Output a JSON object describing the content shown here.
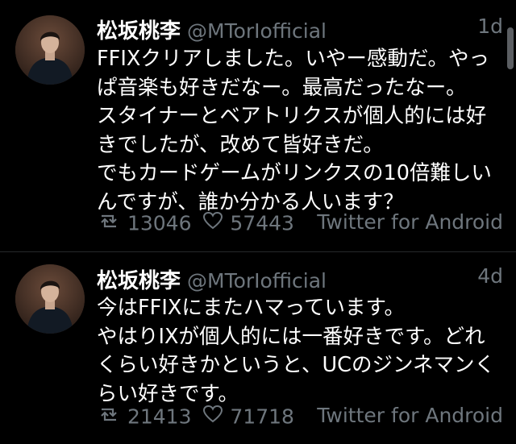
{
  "tweets": [
    {
      "display_name": "松坂桃李",
      "handle": "@MTorIofficial",
      "time": "1d",
      "lines": [
        "FFIXクリアしました。いやー感動だ。やっ",
        "ぱ音楽も好きだなー。最高だったなー。",
        "スタイナーとベアトリクスが個人的には好",
        "きでしたが、改めて皆好きだ。",
        "でもカードゲームがリンクスの10倍難しい",
        "んですが、誰か分かる人います？"
      ],
      "retweets": "13046",
      "likes": "57443",
      "source": "Twitter for Android",
      "retweet_icon": "retweet-icon",
      "like_icon": "heart-icon"
    },
    {
      "display_name": "松坂桃李",
      "handle": "@MTorIofficial",
      "time": "4d",
      "lines": [
        "今はFFIXにまたハマっています。",
        "やはりIXが個人的には一番好きです。どれ",
        "くらい好きかというと、UCのジンネマンく",
        "らい好きです。"
      ],
      "retweets": "21413",
      "likes": "71718",
      "source": "Twitter for Android",
      "retweet_icon": "retweet-icon",
      "like_icon": "heart-icon"
    }
  ],
  "colors": {
    "background": "#000000",
    "text": "#ffffff",
    "muted": "#6e767d",
    "divider": "#26282b"
  }
}
